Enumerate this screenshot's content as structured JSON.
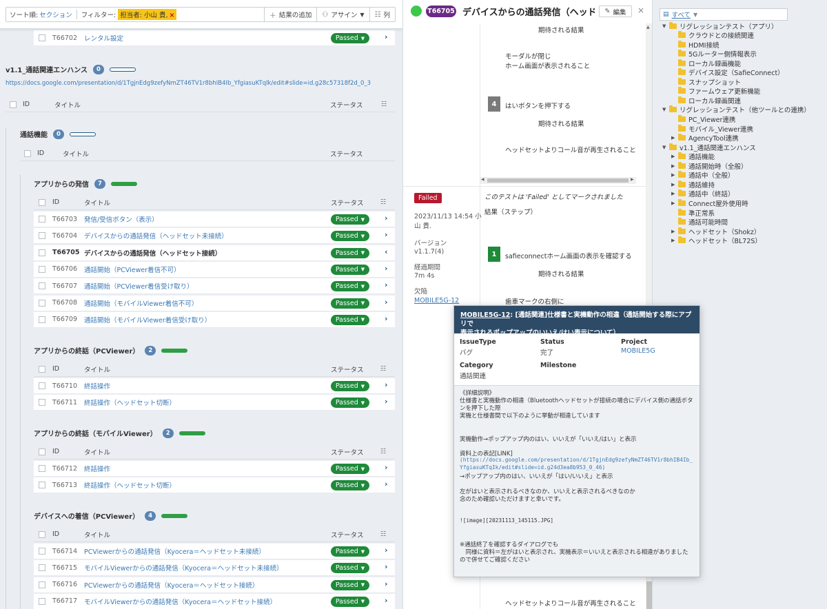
{
  "toolbar": {
    "sort_label": "ソート順:",
    "sort_value": "セクション",
    "filter_label": "フィルター:",
    "filter_chip": "担当者: 小山 貴,",
    "filter_remove": "×",
    "add_result": "結果の追加",
    "assign": "アサイン",
    "columns": "列"
  },
  "list": {
    "top_rows": [
      {
        "id": "T66702",
        "title": "レンタル設定",
        "status": "Passed"
      }
    ],
    "section_main": {
      "title": "v1.1_通話関連エンハンス",
      "count": "0",
      "link": "https://docs.google.com/presentation/d/1TgjnEdg9zefyNmZT46TV1r8bhIB4Ib_YfgiasuKTqlk/edit#slide=id.g28c57318f2d_0_3"
    },
    "header": {
      "id": "ID",
      "title": "タイトル",
      "status": "ステータス"
    },
    "sub_function": {
      "title": "通話機能",
      "count": "0"
    },
    "groups": [
      {
        "title": "アプリからの発信",
        "count": "7",
        "rows": [
          {
            "id": "T66703",
            "title": "発信/受信ボタン（表示）",
            "status": "Passed"
          },
          {
            "id": "T66704",
            "title": "デバイスからの通話発信（ヘッドセット未接続）",
            "status": "Passed"
          },
          {
            "id": "T66705",
            "title": "デバイスからの通話発信（ヘッドセット接続）",
            "status": "Passed"
          },
          {
            "id": "T66706",
            "title": "通話開始（PCViewer着信不可）",
            "status": "Passed"
          },
          {
            "id": "T66707",
            "title": "通話開始（PCViewer着信受け取り）",
            "status": "Passed"
          },
          {
            "id": "T66708",
            "title": "通話開始（モバイルViewer着信不可）",
            "status": "Passed"
          },
          {
            "id": "T66709",
            "title": "通話開始（モバイルViewer着信受け取り）",
            "status": "Passed"
          }
        ]
      },
      {
        "title": "アプリからの終話（PCViewer）",
        "count": "2",
        "rows": [
          {
            "id": "T66710",
            "title": "終話操作",
            "status": "Passed"
          },
          {
            "id": "T66711",
            "title": "終話操作（ヘッドセット切断）",
            "status": "Passed"
          }
        ]
      },
      {
        "title": "アプリからの終話（モバイルViewer）",
        "count": "2",
        "rows": [
          {
            "id": "T66712",
            "title": "終話操作",
            "status": "Passed"
          },
          {
            "id": "T66713",
            "title": "終話操作（ヘッドセット切断）",
            "status": "Passed"
          }
        ]
      },
      {
        "title": "デバイスへの着信（PCViewer）",
        "count": "4",
        "rows": [
          {
            "id": "T66714",
            "title": "PCViewerからの通話発信（Kyocera＝ヘッドセット未接続）",
            "status": "Passed"
          },
          {
            "id": "T66715",
            "title": "モバイルViewerからの通話発信（Kyocera＝ヘッドセット未接続）",
            "status": "Passed"
          },
          {
            "id": "T66716",
            "title": "PCViewerからの通話発信（Kyocera＝ヘッドセット接続）",
            "status": "Passed"
          },
          {
            "id": "T66717",
            "title": "モバイルViewerからの通話発信（Kyocera＝ヘッドセット接続）",
            "status": "Passed"
          }
        ]
      }
    ]
  },
  "detail": {
    "test_id": "T66705",
    "title": "デバイスからの通話発信（ヘッド…",
    "edit_label": "編集",
    "close": "×",
    "step_texts": {
      "expected1": "期待される結果",
      "modal_close": "モーダルが閉じ",
      "home_shown": "ホーム画面が表示されること",
      "step4_num": "4",
      "step4_text": "はいボタンを押下する",
      "expected2": "期待される結果",
      "headset_sound": "ヘッドセットよりコール音が再生されること"
    },
    "result": {
      "status": "Failed",
      "marked_text": "このテストは 'Failed' としてマークされました",
      "result_steps": "結果（ステップ）",
      "date_line1": "2023/11/13 14:54 小",
      "date_line2": "山 貴.",
      "version_label": "バージョン",
      "version_value": "v1.1.7(4)",
      "elapsed_label": "経過期間",
      "elapsed_value": "7m 4s",
      "defect_label": "欠陥",
      "defect_value": "MOBILE5G-12",
      "step1_num": "1",
      "step1_text": "safieconnectホーム画面の表示を確認する",
      "expected3": "期待される結果",
      "gear_text": "歯車マークの右側に",
      "bottom_text": "ヘッドセットよりコール音が再生されること"
    }
  },
  "popup": {
    "key": "MOBILE5G-12",
    "title_line1": ": [通話関連]仕様書と実機動作の相違（通話開始する際にアプリで",
    "title_line2": "表示されるポップアップのいいえ/はい表示について）",
    "fields": {
      "issue_type_label": "IssueType",
      "issue_type_value": "バグ",
      "status_label": "Status",
      "status_value": "完了",
      "project_label": "Project",
      "project_value": "MOBILE5G",
      "category_label": "Category",
      "category_value": "通話関連",
      "milestone_label": "Milestone"
    },
    "desc": [
      "《詳細説明》",
      "仕様書と実機動作の相違（Bluetoothヘッドセットが接続の場合にデバイス側の通話ボタ",
      "ンを押下した際",
      "実機と仕様書間で以下のように挙動が相違しています",
      "実機動作→ポップアップ内のはい、いいえが「いいえ/はい」と表示",
      "資料上の表記[LINK]",
      "(https://docs.google.com/presentation/d/1TgjnEdg9zefyNmZT46TV1r8bhIB4Ib_",
      "YfgiasuKTqIk/edit#slide=id.g24d3ea8b953_0_46)",
      "→ポップアップ内のはい、いいえが「はい/いいえ」と表示",
      "左がはいと表示されるべきなのか、いいえと表示されるべきなのか",
      "念のため確認いただけますと幸いです。",
      "![image][20231113_145115.JPG]",
      "※通話終了を確認するダイアログでも",
      "　同様に資料＝左がはいと表示され、実機表示＝いいえと表示される相違がありました",
      "ので併せてご確認ください"
    ]
  },
  "sidebar": {
    "filter_value": "すべて",
    "nodes": [
      {
        "label": "リグレッションテスト（アプリ）",
        "arrow": "▼",
        "indent": 0
      },
      {
        "label": "クラウドとの接続関連",
        "arrow": "",
        "indent": 1
      },
      {
        "label": "HDMI接続",
        "arrow": "",
        "indent": 1
      },
      {
        "label": "5Gルーター側情報表示",
        "arrow": "",
        "indent": 1
      },
      {
        "label": "ローカル録画機能",
        "arrow": "",
        "indent": 1
      },
      {
        "label": "デバイス設定（SafieConnect）",
        "arrow": "",
        "indent": 1
      },
      {
        "label": "スナップショット",
        "arrow": "",
        "indent": 1
      },
      {
        "label": "ファームウェア更新機能",
        "arrow": "",
        "indent": 1
      },
      {
        "label": "ローカル録画関連",
        "arrow": "",
        "indent": 1
      },
      {
        "label": "リグレッションテスト（他ツールとの連携）",
        "arrow": "▼",
        "indent": 0
      },
      {
        "label": "PC_Viewer連携",
        "arrow": "",
        "indent": 1
      },
      {
        "label": "モバイル_Viewer連携",
        "arrow": "",
        "indent": 1
      },
      {
        "label": "AgencyTool連携",
        "arrow": "▶",
        "indent": 1
      },
      {
        "label": "v1.1_通話関連エンハンス",
        "arrow": "▼",
        "indent": 0
      },
      {
        "label": "通話機能",
        "arrow": "▶",
        "indent": 1
      },
      {
        "label": "通話開始時（全般）",
        "arrow": "▶",
        "indent": 1
      },
      {
        "label": "通話中（全般）",
        "arrow": "▶",
        "indent": 1
      },
      {
        "label": "通話維持",
        "arrow": "▶",
        "indent": 1
      },
      {
        "label": "通話中（終話）",
        "arrow": "▶",
        "indent": 1
      },
      {
        "label": "Connect屋外使用時",
        "arrow": "▶",
        "indent": 1
      },
      {
        "label": "準正常系",
        "arrow": "",
        "indent": 1
      },
      {
        "label": "通話可能時間",
        "arrow": "",
        "indent": 1
      },
      {
        "label": "ヘッドセット（Shokz）",
        "arrow": "▶",
        "indent": 1
      },
      {
        "label": "ヘッドセット（BL72S）",
        "arrow": "▶",
        "indent": 1
      }
    ]
  },
  "colors": {
    "passed": "#1e8a3a",
    "failed": "#b7182c",
    "header": "#2d4a66",
    "accent": "#3a78b5",
    "pill": "#6b2a86"
  }
}
